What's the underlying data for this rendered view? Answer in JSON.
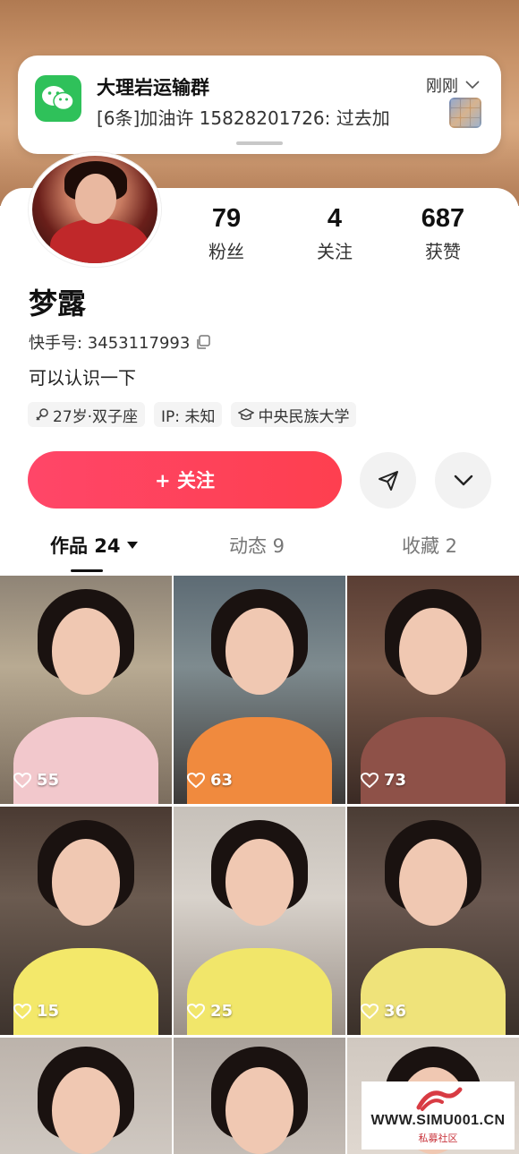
{
  "notification": {
    "app_icon": "wechat-icon",
    "title": "大理岩运输群",
    "message": "[6条]加油许 15828201726: 过去加",
    "time": "刚刚"
  },
  "profile": {
    "stats": [
      {
        "value": "79",
        "label": "粉丝"
      },
      {
        "value": "4",
        "label": "关注"
      },
      {
        "value": "687",
        "label": "获赞"
      }
    ],
    "name": "梦露",
    "id_label": "快手号: 3453117993",
    "bio": "可以认识一下",
    "tags": [
      {
        "icon": "gender-female-icon",
        "text": "27岁·双子座"
      },
      {
        "icon": "",
        "text": "IP: 未知"
      },
      {
        "icon": "school-icon",
        "text": "中央民族大学"
      }
    ],
    "follow_label": "+ 关注"
  },
  "tabs": [
    {
      "label": "作品 24",
      "active": true
    },
    {
      "label": "动态 9",
      "active": false
    },
    {
      "label": "收藏 2",
      "active": false
    }
  ],
  "posts": [
    {
      "likes": "55",
      "shirt_color": "#f2c8cc"
    },
    {
      "likes": "63",
      "shirt_color": "#f08a3e"
    },
    {
      "likes": "73",
      "shirt_color": "#8e5148"
    },
    {
      "likes": "15",
      "shirt_color": "#f3e86a"
    },
    {
      "likes": "25",
      "shirt_color": "#f1e66a"
    },
    {
      "likes": "36",
      "shirt_color": "#efe37a"
    },
    {
      "likes": "",
      "shirt_color": "#e9dccf"
    },
    {
      "likes": "",
      "shirt_color": "#eedfd4"
    },
    {
      "likes": "",
      "shirt_color": "#e3dbd4"
    }
  ],
  "watermark": {
    "text": "WWW.SIMU001.CN",
    "sub": "私募社区"
  },
  "colors": {
    "accent": "#fe3f4f",
    "wechat": "#2fc15a"
  }
}
